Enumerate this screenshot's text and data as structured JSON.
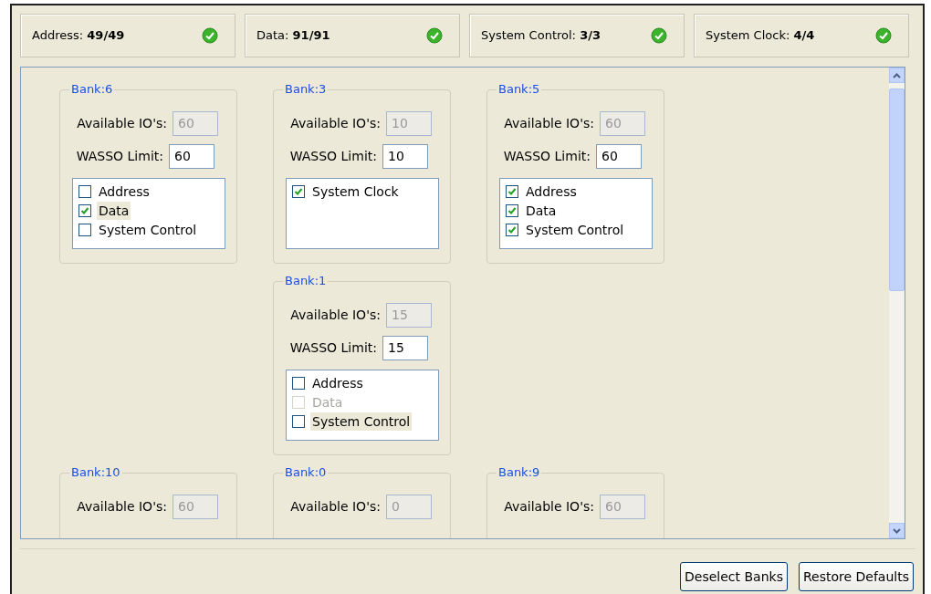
{
  "summary": [
    {
      "label": "Address:",
      "value": "49/49",
      "ok": true
    },
    {
      "label": "Data:",
      "value": "91/91",
      "ok": true
    },
    {
      "label": "System Control:",
      "value": "3/3",
      "ok": true
    },
    {
      "label": "System Clock:",
      "value": "4/4",
      "ok": true
    }
  ],
  "bank_rows": [
    {
      "slots": [
        {
          "kind": "bank",
          "title": "Bank:6",
          "available_label": "Available IO's:",
          "available": "60",
          "wasso_label": "WASSO Limit:",
          "wasso": "60",
          "signals": [
            {
              "label": "Address",
              "checked": false,
              "disabled": false,
              "selected": false
            },
            {
              "label": "Data",
              "checked": true,
              "disabled": false,
              "selected": true
            },
            {
              "label": "System Control",
              "checked": false,
              "disabled": false,
              "selected": false
            }
          ]
        },
        {
          "kind": "bank",
          "title": "Bank:3",
          "available_label": "Available IO's:",
          "available": "10",
          "wasso_label": "WASSO Limit:",
          "wasso": "10",
          "signals": [
            {
              "label": "System Clock",
              "checked": true,
              "disabled": false,
              "selected": false
            }
          ]
        },
        {
          "kind": "bank",
          "title": "Bank:5",
          "available_label": "Available IO's:",
          "available": "60",
          "wasso_label": "WASSO Limit:",
          "wasso": "60",
          "signals": [
            {
              "label": "Address",
              "checked": true,
              "disabled": false,
              "selected": false
            },
            {
              "label": "Data",
              "checked": true,
              "disabled": false,
              "selected": false
            },
            {
              "label": "System Control",
              "checked": true,
              "disabled": false,
              "selected": false
            }
          ]
        }
      ]
    },
    {
      "slots": [
        {
          "kind": "empty"
        },
        {
          "kind": "bank",
          "title": "Bank:1",
          "available_label": "Available IO's:",
          "available": "15",
          "wasso_label": "WASSO Limit:",
          "wasso": "15",
          "signals": [
            {
              "label": "Address",
              "checked": false,
              "disabled": false,
              "selected": false
            },
            {
              "label": "Data",
              "checked": false,
              "disabled": true,
              "selected": false
            },
            {
              "label": "System Control",
              "checked": false,
              "disabled": false,
              "selected": true
            }
          ]
        },
        {
          "kind": "empty"
        }
      ]
    },
    {
      "slots": [
        {
          "kind": "bank",
          "title": "Bank:10",
          "available_label": "Available IO's:",
          "available": "60"
        },
        {
          "kind": "bank",
          "title": "Bank:0",
          "available_label": "Available IO's:",
          "available": "0"
        },
        {
          "kind": "bank",
          "title": "Bank:9",
          "available_label": "Available IO's:",
          "available": "60"
        }
      ]
    }
  ],
  "buttons": [
    {
      "label": "Deselect Banks"
    },
    {
      "label": "Restore Defaults"
    }
  ]
}
